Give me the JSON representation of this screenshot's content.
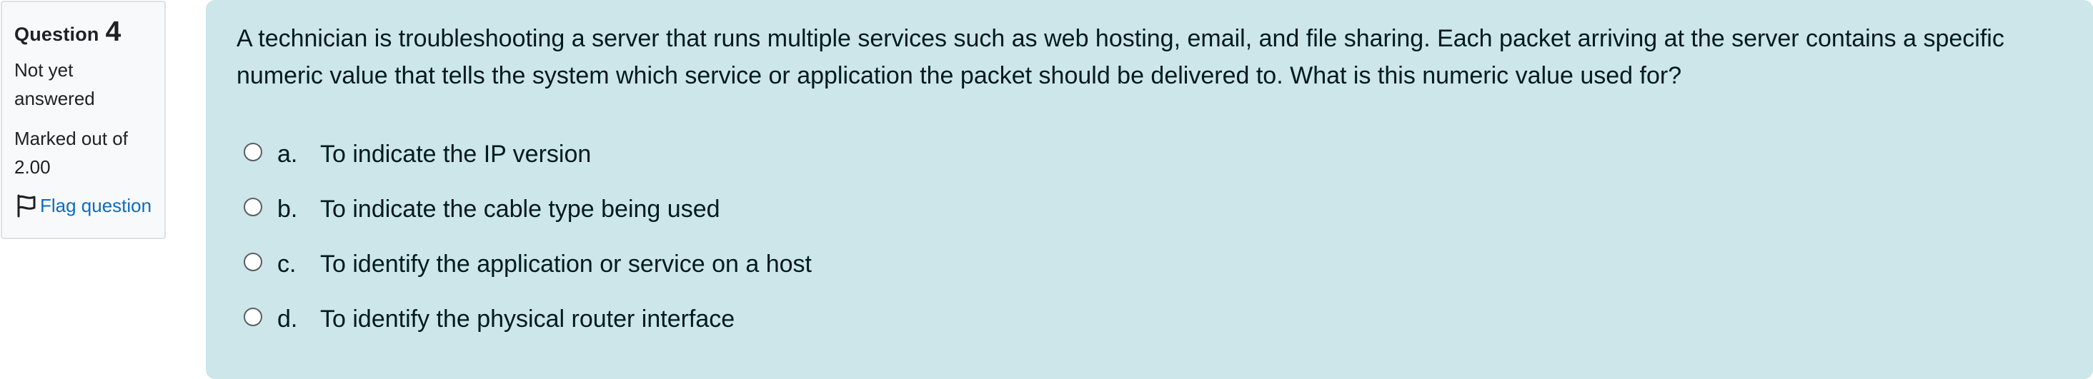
{
  "question_info": {
    "label": "Question",
    "number": "4",
    "state": "Not yet answered",
    "grade": "Marked out of 2.00",
    "flag_label": "Flag question",
    "flag_icon": "flag-outline-icon"
  },
  "question": {
    "text": "A technician is troubleshooting a server that runs multiple services such as web hosting, email, and file sharing. Each packet arriving at the server contains a specific numeric value that tells the system which service or application the packet should be delivered to. What is this numeric value used for?",
    "options": [
      {
        "letter": "a.",
        "text": "To indicate the IP version"
      },
      {
        "letter": "b.",
        "text": "To indicate the cable type being used"
      },
      {
        "letter": "c.",
        "text": "To identify the application or service on a host"
      },
      {
        "letter": "d.",
        "text": "To identify the physical router interface"
      }
    ],
    "selected": null
  },
  "colors": {
    "panel_bg": "#f8f9fa",
    "content_bg": "#cce6ea",
    "link": "#0f6cbf",
    "text": "#001a1e"
  }
}
